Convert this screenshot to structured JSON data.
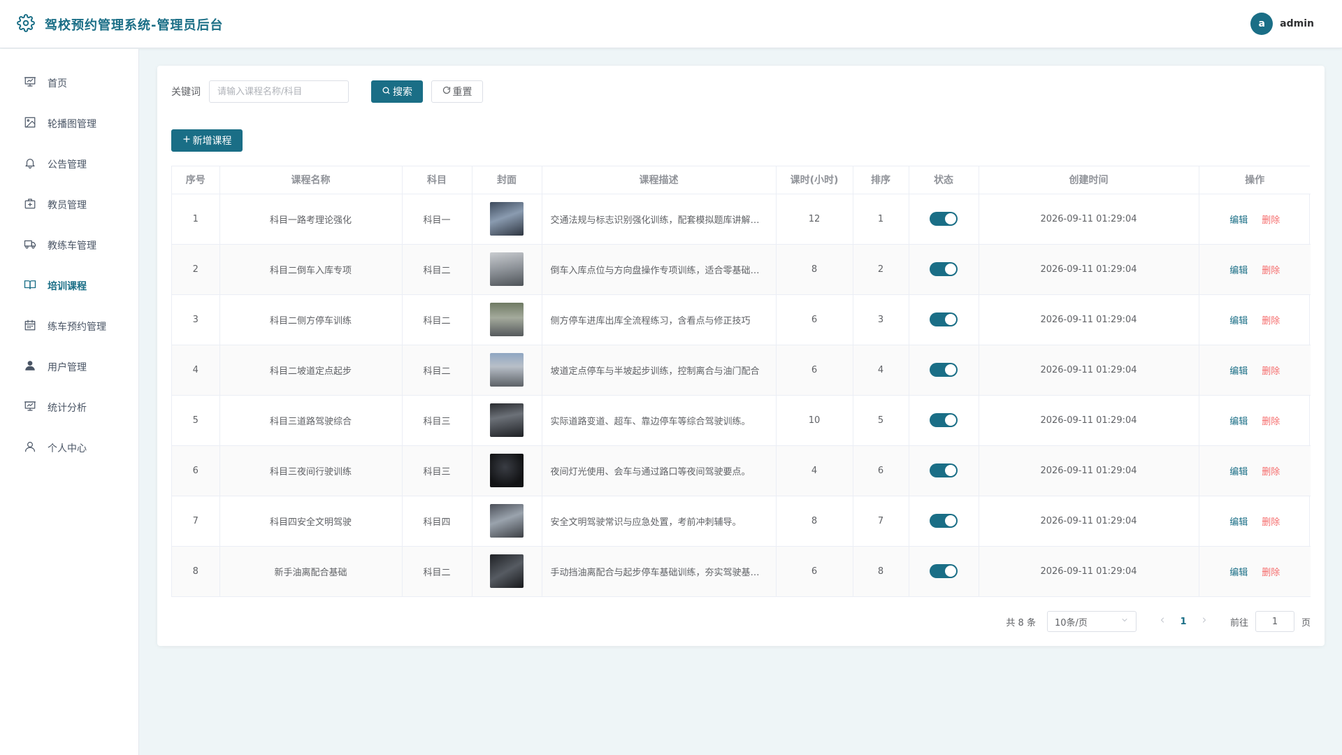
{
  "app": {
    "title": "驾校预约管理系统-管理员后台",
    "logo_icon": "gear-icon"
  },
  "user": {
    "avatar_letter": "a",
    "name": "admin"
  },
  "sidebar": {
    "items": [
      {
        "label": "首页",
        "icon": "presentation-icon",
        "active": false
      },
      {
        "label": "轮播图管理",
        "icon": "image-icon",
        "active": false
      },
      {
        "label": "公告管理",
        "icon": "bell-icon",
        "active": false
      },
      {
        "label": "教员管理",
        "icon": "medical-box-icon",
        "active": false
      },
      {
        "label": "教练车管理",
        "icon": "truck-icon",
        "active": false
      },
      {
        "label": "培训课程",
        "icon": "book-icon",
        "active": true
      },
      {
        "label": "练车预约管理",
        "icon": "calendar-icon",
        "active": false
      },
      {
        "label": "用户管理",
        "icon": "user-filled-icon",
        "active": false
      },
      {
        "label": "统计分析",
        "icon": "chart-board-icon",
        "active": false
      },
      {
        "label": "个人中心",
        "icon": "user-icon",
        "active": false
      }
    ]
  },
  "search": {
    "label": "关键词",
    "placeholder": "请输入课程名称/科目",
    "value": "",
    "search_label": "搜索",
    "reset_label": "重置"
  },
  "toolbar": {
    "add_label": "新增课程"
  },
  "table": {
    "headers": [
      "序号",
      "课程名称",
      "科目",
      "封面",
      "课程描述",
      "课时(小时)",
      "排序",
      "状态",
      "创建时间",
      "操作"
    ],
    "edit_label": "编辑",
    "delete_label": "删除",
    "rows": [
      {
        "index": "1",
        "name": "科目一路考理论强化",
        "subject": "科目一",
        "description": "交通法规与标志识别强化训练，配套模拟题库讲解与易错点分析",
        "hours": "12",
        "sort": "1",
        "status_on": true,
        "created": "2026-09-11 01:29:04"
      },
      {
        "index": "2",
        "name": "科目二倒车入库专项",
        "subject": "科目二",
        "description": "倒车入库点位与方向盘操作专项训练，适合零基础学员",
        "hours": "8",
        "sort": "2",
        "status_on": true,
        "created": "2026-09-11 01:29:04"
      },
      {
        "index": "3",
        "name": "科目二侧方停车训练",
        "subject": "科目二",
        "description": "侧方停车进库出库全流程练习，含看点与修正技巧",
        "hours": "6",
        "sort": "3",
        "status_on": true,
        "created": "2026-09-11 01:29:04"
      },
      {
        "index": "4",
        "name": "科目二坡道定点起步",
        "subject": "科目二",
        "description": "坡道定点停车与半坡起步训练，控制离合与油门配合",
        "hours": "6",
        "sort": "4",
        "status_on": true,
        "created": "2026-09-11 01:29:04"
      },
      {
        "index": "5",
        "name": "科目三道路驾驶综合",
        "subject": "科目三",
        "description": "实际道路变道、超车、靠边停车等综合驾驶训练。",
        "hours": "10",
        "sort": "5",
        "status_on": true,
        "created": "2026-09-11 01:29:04"
      },
      {
        "index": "6",
        "name": "科目三夜间行驶训练",
        "subject": "科目三",
        "description": "夜间灯光使用、会车与通过路口等夜间驾驶要点。",
        "hours": "4",
        "sort": "6",
        "status_on": true,
        "created": "2026-09-11 01:29:04"
      },
      {
        "index": "7",
        "name": "科目四安全文明驾驶",
        "subject": "科目四",
        "description": "安全文明驾驶常识与应急处置，考前冲刺辅导。",
        "hours": "8",
        "sort": "7",
        "status_on": true,
        "created": "2026-09-11 01:29:04"
      },
      {
        "index": "8",
        "name": "新手油离配合基础",
        "subject": "科目二",
        "description": "手动挡油离配合与起步停车基础训练，夯实驾驶基本功",
        "hours": "6",
        "sort": "8",
        "status_on": true,
        "created": "2026-09-11 01:29:04"
      }
    ]
  },
  "pagination": {
    "total_text": "共 8 条",
    "page_size": "10条/页",
    "current_page": "1",
    "goto_label": "前往",
    "goto_value": "1",
    "page_suffix": "页"
  },
  "colors": {
    "accent": "#1a6e86",
    "danger": "#f56c6c",
    "background": "#eef5f7"
  }
}
